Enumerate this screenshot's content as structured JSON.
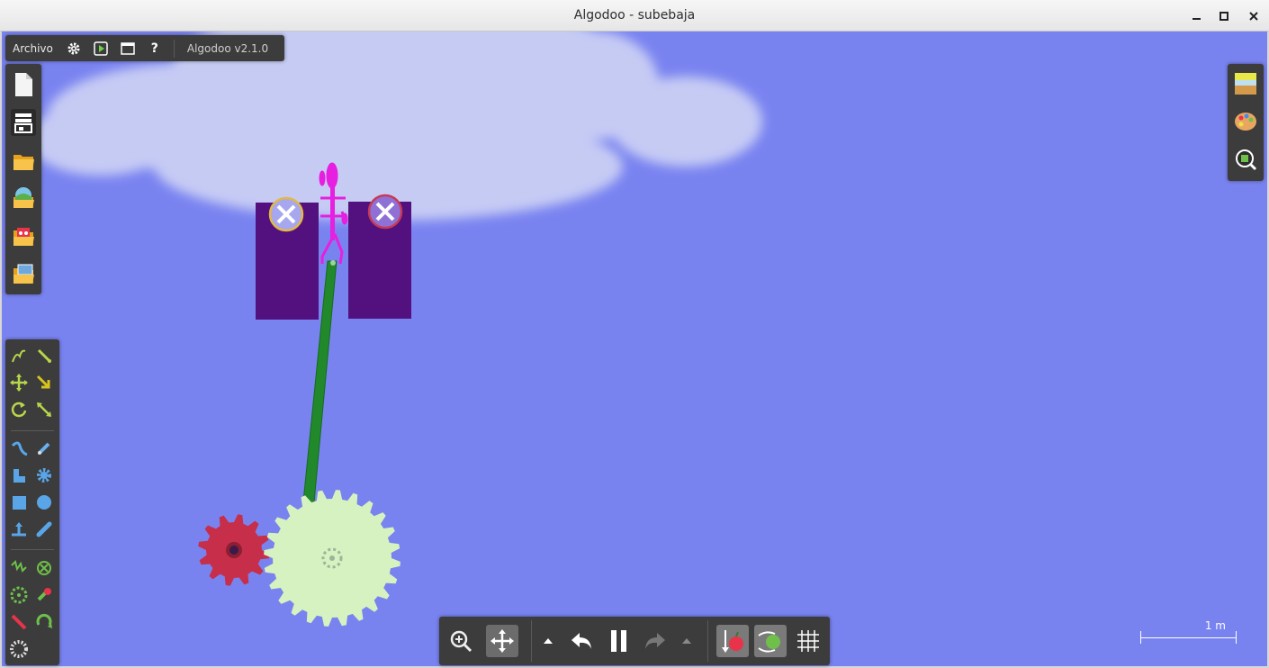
{
  "window": {
    "title": "Algodoo - subebaja",
    "minimize_glyph": "✕",
    "maximize_glyph": "■",
    "close_glyph": "✕"
  },
  "menubar": {
    "file_menu": "Archivo",
    "version": "Algodoo v2.1.0",
    "icons": [
      "gear-icon",
      "play-scene-icon",
      "window-icon",
      "help-icon"
    ],
    "help_glyph": "?"
  },
  "filebar": {
    "items": [
      "new-scene-icon",
      "toolbox-icon",
      "open-folder-icon",
      "open-scene-icon",
      "phunlets-icon",
      "save-icon"
    ]
  },
  "toolbar": {
    "groups": [
      [
        "sketch-tool-icon",
        "cut-tool-icon",
        "move-tool-icon",
        "drag-tool-icon",
        "rotate-tool-icon",
        "scale-tool-icon"
      ],
      [
        "rope-tool-icon",
        "brush-tool-icon",
        "polygon-tool-icon",
        "gear-tool-icon",
        "box-tool-icon",
        "circle-tool-icon",
        "plane-tool-icon",
        "chain-tool-icon"
      ],
      [
        "spring-tool-icon",
        "fixate-tool-icon",
        "axle-tool-icon",
        "tracer-tool-icon",
        "laser-tool-icon",
        "thruster-tool-icon",
        "fan-tool-icon"
      ]
    ]
  },
  "rightbar": {
    "items": [
      "background-icon",
      "palette-icon",
      "inspect-icon"
    ]
  },
  "bottombar": {
    "items": [
      "zoom-icon",
      "pan-icon",
      "speed-down-icon",
      "undo-icon",
      "pause-icon",
      "redo-icon",
      "speed-up-icon",
      "gravity-icon",
      "air-friction-icon",
      "grid-icon"
    ]
  },
  "scale": {
    "label": "1 m"
  },
  "colors": {
    "sky": "#7983f0",
    "cloud": "#c6cbf4",
    "block": "#52117f",
    "rod": "#21892b",
    "figure": "#e61fe0",
    "big_gear": "#d6f2c0",
    "small_gear": "#c72e4a",
    "panel": "#3c3c3c"
  }
}
